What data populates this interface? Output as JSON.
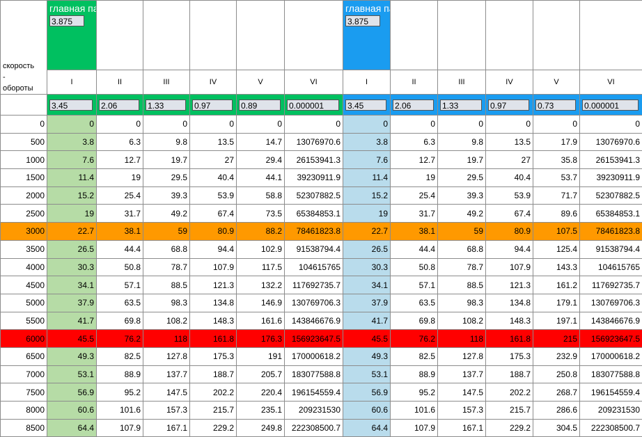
{
  "header": {
    "row_label_top": "скорость\n-\nобороты",
    "main_pair_left_label": "главная пара",
    "main_pair_left_value": "3.875",
    "main_pair_right_label": "главная пара",
    "main_pair_right_value": "3.875"
  },
  "gears": [
    "I",
    "II",
    "III",
    "IV",
    "V",
    "VI",
    "I",
    "II",
    "III",
    "IV",
    "V",
    "VI"
  ],
  "ratios": [
    "3.45",
    "2.06",
    "1.33",
    "0.97",
    "0.89",
    "0.000001",
    "3.45",
    "2.06",
    "1.33",
    "0.97",
    "0.73",
    "0.000001"
  ],
  "rows": [
    {
      "rpm": "0",
      "v": [
        "0",
        "0",
        "0",
        "0",
        "0",
        "0",
        "0",
        "0",
        "0",
        "0",
        "0",
        "0"
      ]
    },
    {
      "rpm": "500",
      "v": [
        "3.8",
        "6.3",
        "9.8",
        "13.5",
        "14.7",
        "13076970.6",
        "3.8",
        "6.3",
        "9.8",
        "13.5",
        "17.9",
        "13076970.6"
      ]
    },
    {
      "rpm": "1000",
      "v": [
        "7.6",
        "12.7",
        "19.7",
        "27",
        "29.4",
        "26153941.3",
        "7.6",
        "12.7",
        "19.7",
        "27",
        "35.8",
        "26153941.3"
      ]
    },
    {
      "rpm": "1500",
      "v": [
        "11.4",
        "19",
        "29.5",
        "40.4",
        "44.1",
        "39230911.9",
        "11.4",
        "19",
        "29.5",
        "40.4",
        "53.7",
        "39230911.9"
      ]
    },
    {
      "rpm": "2000",
      "v": [
        "15.2",
        "25.4",
        "39.3",
        "53.9",
        "58.8",
        "52307882.5",
        "15.2",
        "25.4",
        "39.3",
        "53.9",
        "71.7",
        "52307882.5"
      ]
    },
    {
      "rpm": "2500",
      "v": [
        "19",
        "31.7",
        "49.2",
        "67.4",
        "73.5",
        "65384853.1",
        "19",
        "31.7",
        "49.2",
        "67.4",
        "89.6",
        "65384853.1"
      ]
    },
    {
      "rpm": "3000",
      "v": [
        "22.7",
        "38.1",
        "59",
        "80.9",
        "88.2",
        "78461823.8",
        "22.7",
        "38.1",
        "59",
        "80.9",
        "107.5",
        "78461823.8"
      ],
      "highlight": "orange"
    },
    {
      "rpm": "3500",
      "v": [
        "26.5",
        "44.4",
        "68.8",
        "94.4",
        "102.9",
        "91538794.4",
        "26.5",
        "44.4",
        "68.8",
        "94.4",
        "125.4",
        "91538794.4"
      ]
    },
    {
      "rpm": "4000",
      "v": [
        "30.3",
        "50.8",
        "78.7",
        "107.9",
        "117.5",
        "104615765",
        "30.3",
        "50.8",
        "78.7",
        "107.9",
        "143.3",
        "104615765"
      ]
    },
    {
      "rpm": "4500",
      "v": [
        "34.1",
        "57.1",
        "88.5",
        "121.3",
        "132.2",
        "117692735.7",
        "34.1",
        "57.1",
        "88.5",
        "121.3",
        "161.2",
        "117692735.7"
      ]
    },
    {
      "rpm": "5000",
      "v": [
        "37.9",
        "63.5",
        "98.3",
        "134.8",
        "146.9",
        "130769706.3",
        "37.9",
        "63.5",
        "98.3",
        "134.8",
        "179.1",
        "130769706.3"
      ]
    },
    {
      "rpm": "5500",
      "v": [
        "41.7",
        "69.8",
        "108.2",
        "148.3",
        "161.6",
        "143846676.9",
        "41.7",
        "69.8",
        "108.2",
        "148.3",
        "197.1",
        "143846676.9"
      ]
    },
    {
      "rpm": "6000",
      "v": [
        "45.5",
        "76.2",
        "118",
        "161.8",
        "176.3",
        "156923647.5",
        "45.5",
        "76.2",
        "118",
        "161.8",
        "215",
        "156923647.5"
      ],
      "highlight": "red"
    },
    {
      "rpm": "6500",
      "v": [
        "49.3",
        "82.5",
        "127.8",
        "175.3",
        "191",
        "170000618.2",
        "49.3",
        "82.5",
        "127.8",
        "175.3",
        "232.9",
        "170000618.2"
      ]
    },
    {
      "rpm": "7000",
      "v": [
        "53.1",
        "88.9",
        "137.7",
        "188.7",
        "205.7",
        "183077588.8",
        "53.1",
        "88.9",
        "137.7",
        "188.7",
        "250.8",
        "183077588.8"
      ]
    },
    {
      "rpm": "7500",
      "v": [
        "56.9",
        "95.2",
        "147.5",
        "202.2",
        "220.4",
        "196154559.4",
        "56.9",
        "95.2",
        "147.5",
        "202.2",
        "268.7",
        "196154559.4"
      ]
    },
    {
      "rpm": "8000",
      "v": [
        "60.6",
        "101.6",
        "157.3",
        "215.7",
        "235.1",
        "209231530",
        "60.6",
        "101.6",
        "157.3",
        "215.7",
        "286.6",
        "209231530"
      ]
    },
    {
      "rpm": "8500",
      "v": [
        "64.4",
        "107.9",
        "167.1",
        "229.2",
        "249.8",
        "222308500.7",
        "64.4",
        "107.9",
        "167.1",
        "229.2",
        "304.5",
        "222308500.7"
      ]
    }
  ]
}
